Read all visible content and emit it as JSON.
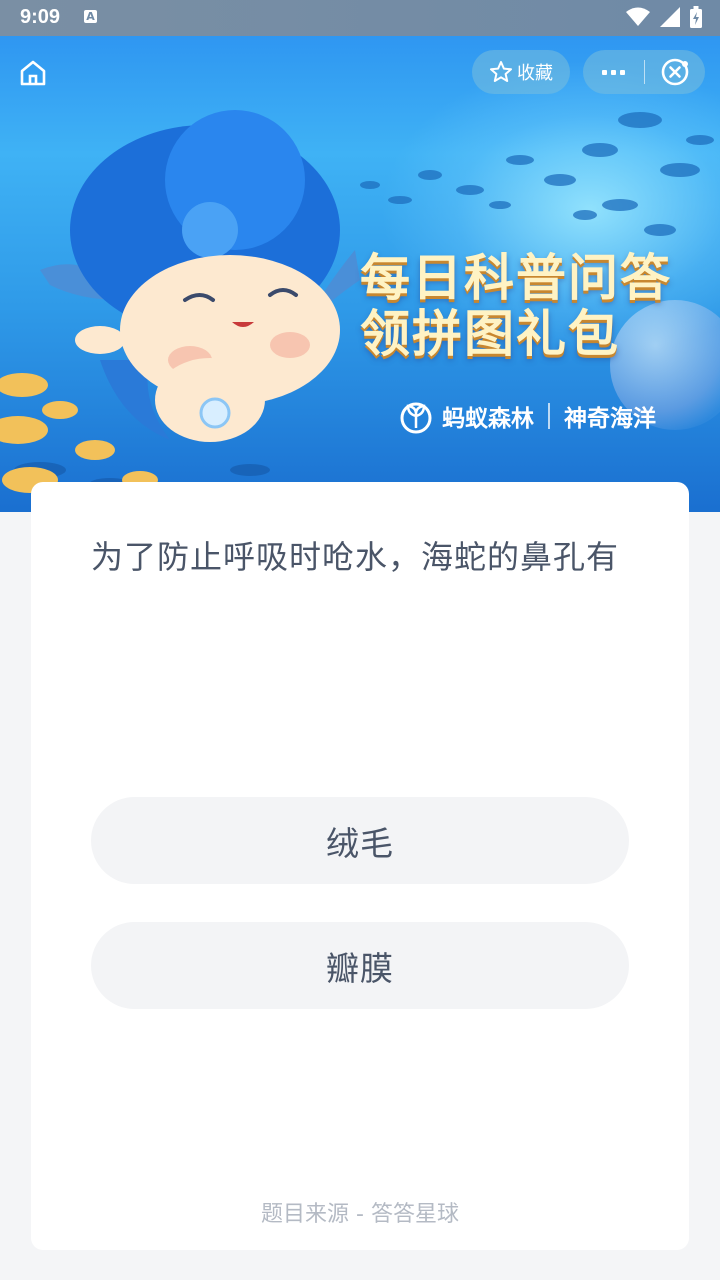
{
  "status_bar": {
    "time": "9:09",
    "notification_icon": "A"
  },
  "nav": {
    "home_icon": "home-icon",
    "favorite_label": "收藏",
    "more_icon": "more-icon",
    "close_icon": "close-mini-program-icon"
  },
  "banner": {
    "title_line1": "每日科普问答",
    "title_line2": "领拼图礼包",
    "brand_left": "蚂蚁森林",
    "brand_right": "神奇海洋"
  },
  "quiz": {
    "question": "为了防止呼吸时呛水，海蛇的鼻孔有",
    "options": [
      {
        "label": "绒毛"
      },
      {
        "label": "瓣膜"
      }
    ],
    "source": "题目来源 - 答答星球"
  },
  "colors": {
    "accent_text": "#4a5568",
    "option_bg": "#f3f4f6",
    "page_bg": "#f4f5f7",
    "banner_blue": "#2a8ef0"
  }
}
